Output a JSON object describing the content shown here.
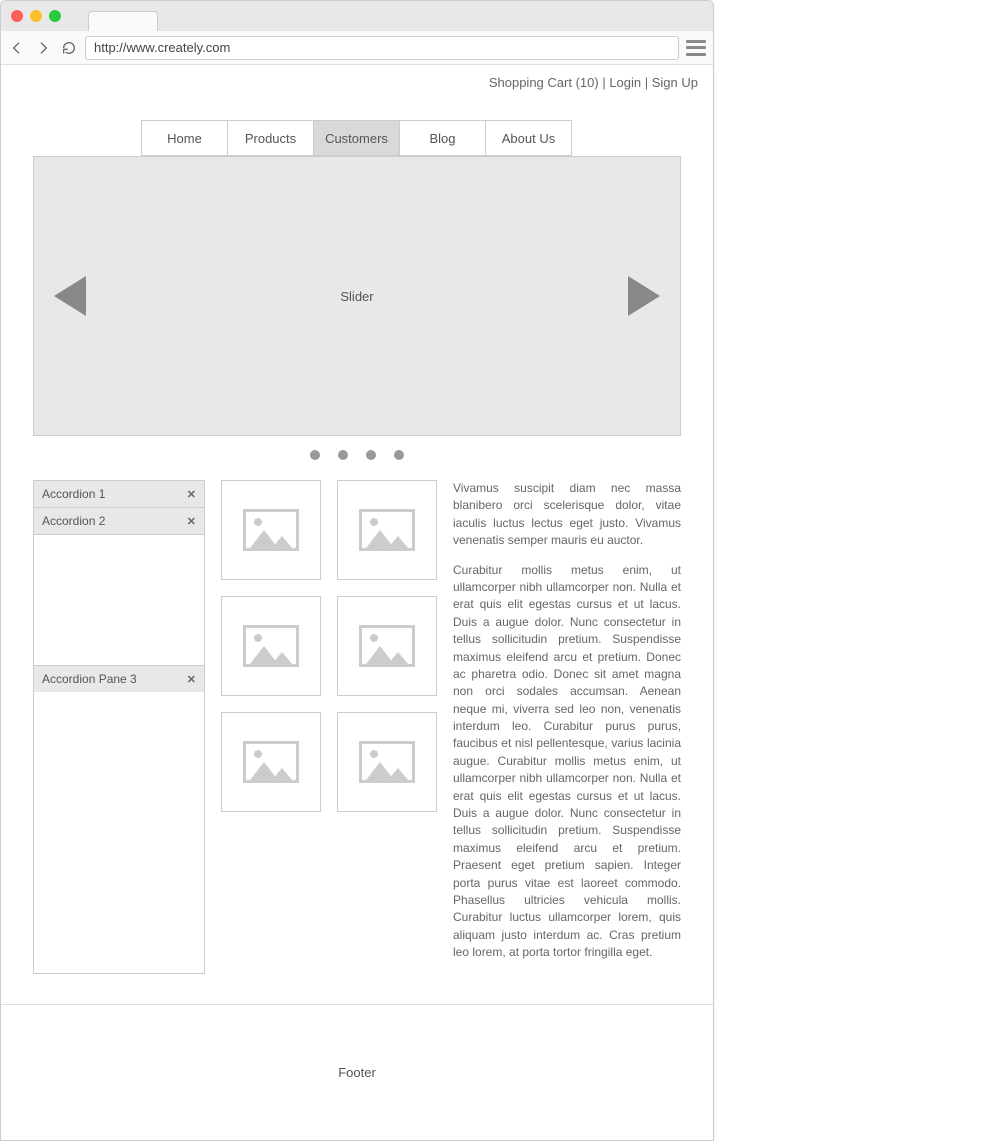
{
  "browser": {
    "url": "http://www.creately.com"
  },
  "header": {
    "cart_label": "Shopping Cart (10)",
    "login_label": "Login",
    "signup_label": "Sign Up",
    "separator": "  |  "
  },
  "nav": {
    "tabs": [
      {
        "label": "Home"
      },
      {
        "label": "Products"
      },
      {
        "label": "Customers"
      },
      {
        "label": "Blog"
      },
      {
        "label": "About Us"
      }
    ],
    "active_index": 2
  },
  "slider": {
    "label": "Slider",
    "dot_count": 4
  },
  "accordion": {
    "items": [
      {
        "label": "Accordion 1",
        "expanded": false
      },
      {
        "label": "Accordion 2",
        "expanded": true
      },
      {
        "label": "Accordion Pane 3",
        "expanded": false
      }
    ]
  },
  "gallery": {
    "count": 6
  },
  "copy": {
    "p1": "Vivamus suscipit diam nec massa blanibero orci scelerisque dolor, vitae iaculis luctus lectus eget justo. Vivamus venenatis semper mauris eu auctor.",
    "p2": "Curabitur mollis metus enim, ut ullamcorper nibh ullamcorper non. Nulla et erat quis elit egestas cursus et ut lacus. Duis a augue dolor. Nunc consectetur in tellus sollicitudin pretium. Suspendisse maximus eleifend arcu et pretium. Donec ac pharetra odio. Donec sit amet magna non orci sodales accumsan. Aenean neque mi, viverra sed leo non, venenatis interdum leo. Curabitur purus purus, faucibus et nisl pellentesque, varius lacinia augue. Curabitur mollis metus enim, ut ullamcorper nibh ullamcorper non. Nulla et erat quis elit egestas cursus et ut lacus. Duis a augue dolor. Nunc consectetur in tellus sollicitudin pretium. Suspendisse maximus eleifend arcu et pretium. Praesent eget pretium sapien. Integer porta purus vitae est laoreet commodo. Phasellus ultricies vehicula mollis. Curabitur luctus ullamcorper lorem, quis aliquam justo interdum ac. Cras pretium leo lorem, at porta tortor fringilla eget."
  },
  "footer": {
    "label": "Footer"
  }
}
